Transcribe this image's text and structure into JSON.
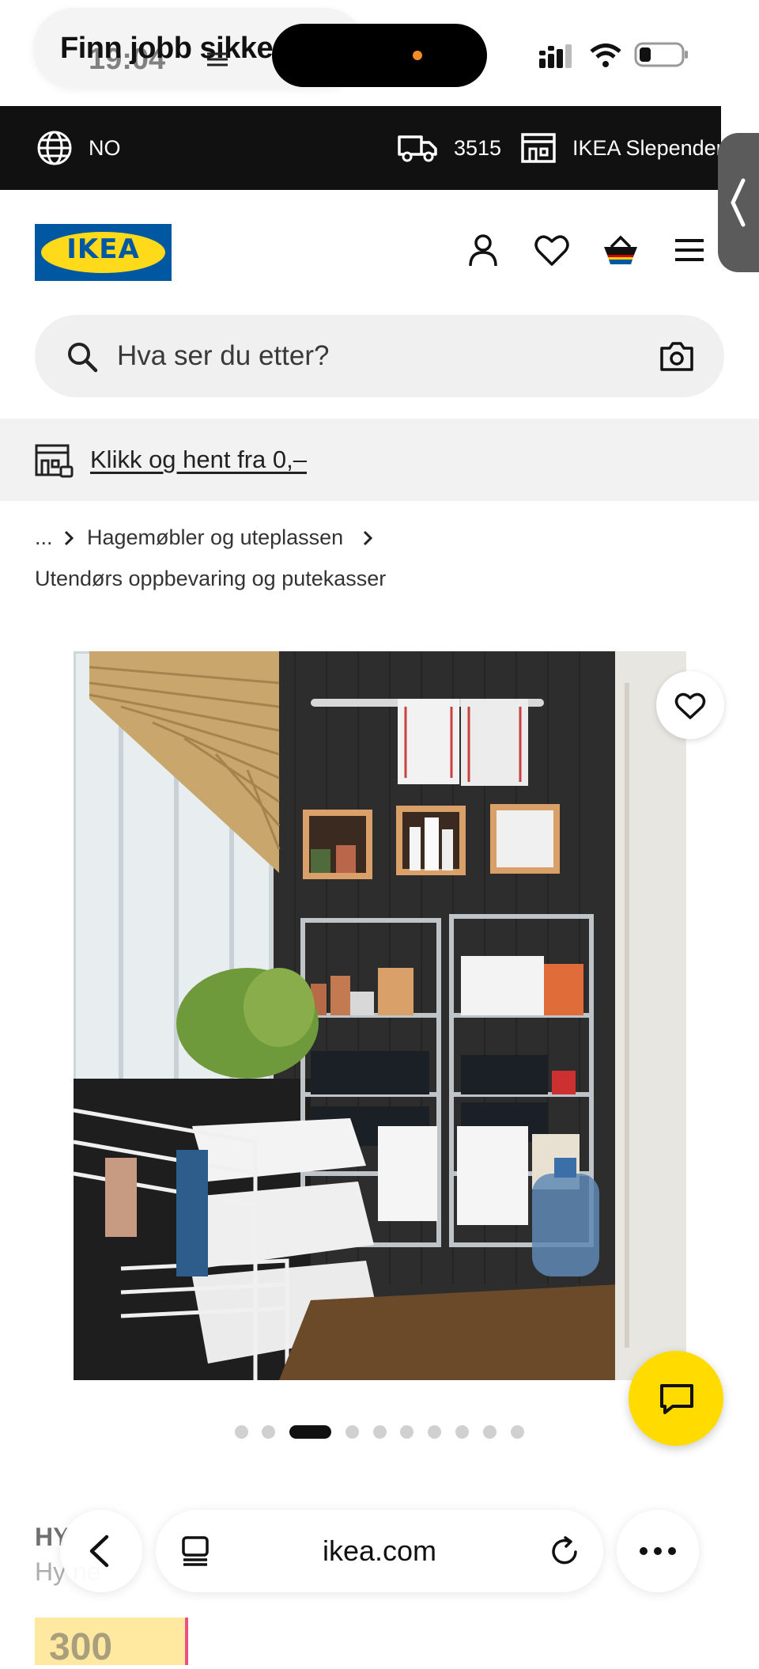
{
  "status_bar": {
    "notification_text": "Finn jobb sikker",
    "time": "19:04"
  },
  "top_bar": {
    "language": "NO",
    "postcode": "3515",
    "store": "IKEA Slependen"
  },
  "header": {
    "logo_text": "IKEA"
  },
  "search": {
    "placeholder": "Hva ser du etter?"
  },
  "promo": {
    "link_text": "Klikk og hent fra 0,–"
  },
  "breadcrumb": {
    "ellipsis": "...",
    "level1": "Hagemøbler og uteplassen",
    "current": "Utendørs oppbevaring og putekasser"
  },
  "carousel": {
    "total": 10,
    "active_index": 2
  },
  "product": {
    "title_partial": "HY",
    "subtitle_partial": "Hy    ne",
    "price_partial": "300"
  },
  "browser": {
    "url": "ikea.com"
  },
  "colors": {
    "ikea_blue": "#0058a3",
    "ikea_yellow": "#ffda1a",
    "top_bar": "#111111",
    "chat_button": "#ffdb00"
  }
}
